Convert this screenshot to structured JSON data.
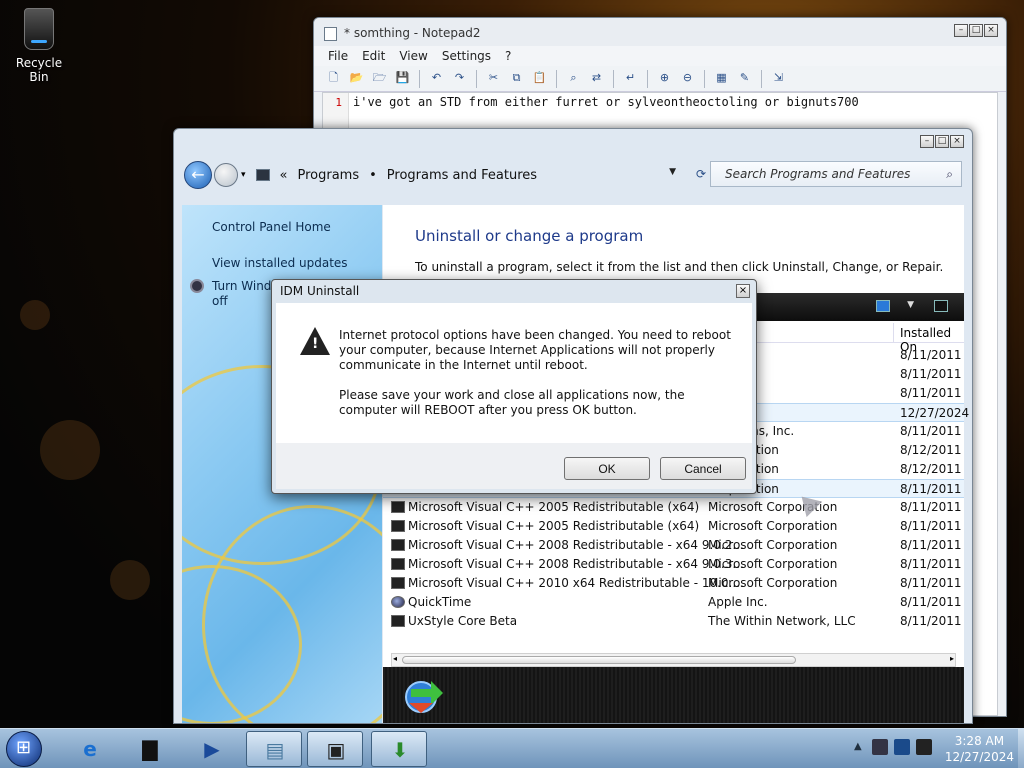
{
  "desktop": {
    "recycle_bin_label": "Recycle Bin"
  },
  "notepad": {
    "title": "* somthing - Notepad2",
    "menu": [
      "File",
      "Edit",
      "View",
      "Settings",
      "?"
    ],
    "line_number": "1",
    "text": "i've got an STD from either furret or sylveontheoctoling or bignuts700"
  },
  "explorer": {
    "breadcrumb": {
      "chevrons": "«",
      "programs": "Programs",
      "separator": "•",
      "current": "Programs and Features"
    },
    "search_placeholder": "Search Programs and Features",
    "sidebar": {
      "control_panel_home": "Control Panel Home",
      "view_installed_updates": "View installed updates",
      "turn_windows_features_line1": "Turn Windo",
      "turn_windows_features_line2": "off"
    },
    "heading": "Uninstall or change a program",
    "instruction": "To uninstall a program, select it from the list and then click Uninstall, Change, or Repair.",
    "columns": {
      "installed_on": "Installed On"
    },
    "rows": [
      {
        "name": "",
        "publisher": "ov",
        "date": "8/11/2011",
        "selected": false
      },
      {
        "name": "",
        "publisher": ".",
        "date": "8/11/2011",
        "selected": false
      },
      {
        "name": "",
        "publisher": ".",
        "date": "8/11/2011",
        "selected": false
      },
      {
        "name": "",
        "publisher": "",
        "date": "12/27/2024",
        "selected": true
      },
      {
        "name": "",
        "publisher": "osystems, Inc.",
        "date": "8/11/2011",
        "selected": false
      },
      {
        "name": "",
        "publisher": "Corporation",
        "date": "8/12/2011",
        "selected": false
      },
      {
        "name": "",
        "publisher": "Corporation",
        "date": "8/12/2011",
        "selected": false
      },
      {
        "name": "",
        "publisher": "Corporation",
        "date": "8/11/2011",
        "selected": true
      },
      {
        "name": "Microsoft Visual C++ 2005 Redistributable (x64)",
        "publisher": "Microsoft Corporation",
        "date": "8/11/2011",
        "selected": false
      },
      {
        "name": "Microsoft Visual C++ 2005 Redistributable (x64)",
        "publisher": "Microsoft Corporation",
        "date": "8/11/2011",
        "selected": false
      },
      {
        "name": "Microsoft Visual C++ 2008 Redistributable - x64 9.0.2...",
        "publisher": "Microsoft Corporation",
        "date": "8/11/2011",
        "selected": false
      },
      {
        "name": "Microsoft Visual C++ 2008 Redistributable - x64 9.0.3...",
        "publisher": "Microsoft Corporation",
        "date": "8/11/2011",
        "selected": false
      },
      {
        "name": "Microsoft Visual C++ 2010  x64 Redistributable - 10.0....",
        "publisher": "Microsoft Corporation",
        "date": "8/11/2011",
        "selected": false
      },
      {
        "name": "QuickTime",
        "publisher": "Apple Inc.",
        "date": "8/11/2011",
        "selected": false
      },
      {
        "name": "UxStyle Core Beta",
        "publisher": "The Within Network, LLC",
        "date": "8/11/2011",
        "selected": false
      }
    ]
  },
  "dialog": {
    "title": "IDM Uninstall",
    "message1": "Internet protocol options have been changed. You need to reboot your computer, because Internet Applications will not properly communicate in the Internet until reboot.",
    "message2": "Please save your work and close all applications now, the computer will REBOOT after you press OK button.",
    "ok_label": "OK",
    "cancel_label": "Cancel"
  },
  "taskbar": {
    "time": "3:28 AM",
    "date": "12/27/2024"
  },
  "colors": {
    "heading_blue": "#1e3a8a",
    "taskbar": "#8fb0d0"
  }
}
